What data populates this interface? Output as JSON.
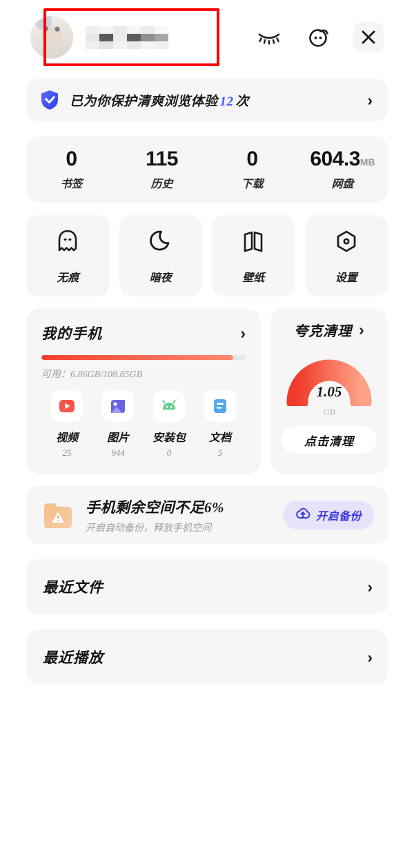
{
  "header": {
    "avatar_alt": "cat-avatar",
    "username_masked": "",
    "icons": [
      {
        "name": "closed-eye-icon",
        "label": "隐身"
      },
      {
        "name": "face-skin-icon",
        "label": "皮肤"
      },
      {
        "name": "close-icon",
        "label": "关闭"
      }
    ]
  },
  "shield_banner": {
    "icon": "shield-check-icon",
    "text_before": "已为你保护清爽浏览体验",
    "count": "12",
    "text_after": "次",
    "chevron": "›"
  },
  "stats": [
    {
      "num": "0",
      "unit": "",
      "label": "书签"
    },
    {
      "num": "115",
      "unit": "",
      "label": "历史"
    },
    {
      "num": "0",
      "unit": "",
      "label": "下载"
    },
    {
      "num": "604.3",
      "unit": "MB",
      "label": "网盘"
    }
  ],
  "quick_actions": [
    {
      "icon": "ghost-icon",
      "label": "无痕"
    },
    {
      "icon": "moon-icon",
      "label": "暗夜"
    },
    {
      "icon": "book-wallpaper-icon",
      "label": "壁纸"
    },
    {
      "icon": "hexagon-settings-icon",
      "label": "设置"
    }
  ],
  "phone_card": {
    "title": "我的手机",
    "chevron": "›",
    "available_label": "可用：6.86GB/108.85GB",
    "used_percent": 94,
    "file_types": [
      {
        "icon": "video-icon",
        "name": "视频",
        "count": "25",
        "color": "#f5554a"
      },
      {
        "icon": "image-icon",
        "name": "图片",
        "count": "944",
        "color": "#6b63e0"
      },
      {
        "icon": "apk-android-icon",
        "name": "安装包",
        "count": "0",
        "color": "#5fcd8e"
      },
      {
        "icon": "document-icon",
        "name": "文档",
        "count": "5",
        "color": "#53a8f0"
      }
    ]
  },
  "clean_card": {
    "title": "夸克清理",
    "chevron": "›",
    "value": "1.05",
    "unit": "GB",
    "button_label": "点击清理",
    "gauge_color_start": "#ef3b2c",
    "gauge_color_end": "#fb9b80"
  },
  "warn_banner": {
    "icon": "folder-warning-icon",
    "title": "手机剩余空间不足6%",
    "subtitle": "开启自动备份，释放手机空间",
    "button_icon": "cloud-upload-icon",
    "button_label": "开启备份"
  },
  "list_rows": [
    {
      "title": "最近文件",
      "chevron": "›"
    },
    {
      "title": "最近播放",
      "chevron": "›"
    }
  ]
}
